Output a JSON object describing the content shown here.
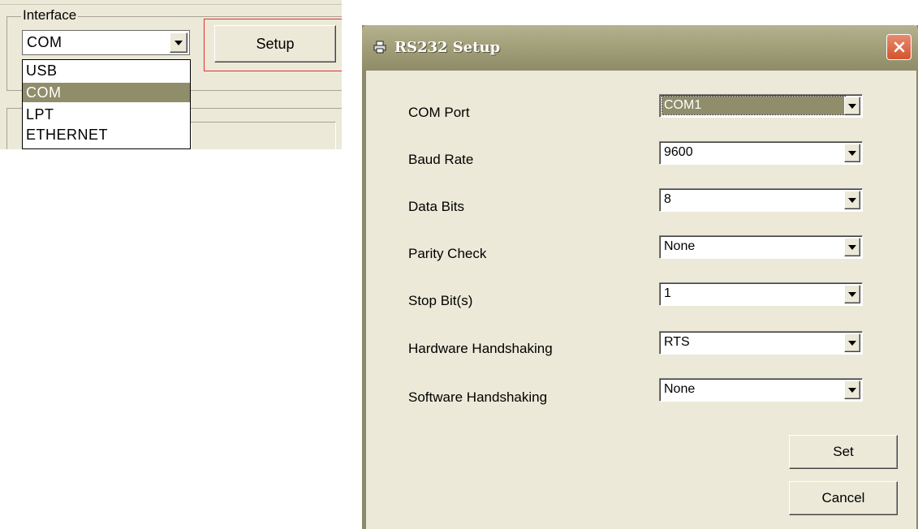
{
  "interface_panel": {
    "legend": "Interface",
    "selected_value": "COM",
    "options": [
      "USB",
      "COM",
      "LPT",
      "ETHERNET"
    ],
    "highlighted_option": "COM",
    "setup_label": "Setup"
  },
  "dialog": {
    "title": "RS232 Setup",
    "fields": [
      {
        "label": "COM Port",
        "value": "COM1"
      },
      {
        "label": "Baud Rate",
        "value": "9600"
      },
      {
        "label": "Data Bits",
        "value": "8"
      },
      {
        "label": "Parity Check",
        "value": "None"
      },
      {
        "label": "Stop Bit(s)",
        "value": "1"
      },
      {
        "label": "Hardware Handshaking",
        "value": "RTS"
      },
      {
        "label": "Software Handshaking",
        "value": "None"
      }
    ],
    "set_label": "Set",
    "cancel_label": "Cancel"
  },
  "colors": {
    "highlight": "#908d6b",
    "annotation_box": "#e0302b",
    "titlebar": "#a3a07a",
    "close": "#d5532e"
  },
  "icons": {
    "title_icon": "printer-icon",
    "close_icon": "close-icon",
    "dropdown_icon": "chevron-down-icon"
  }
}
